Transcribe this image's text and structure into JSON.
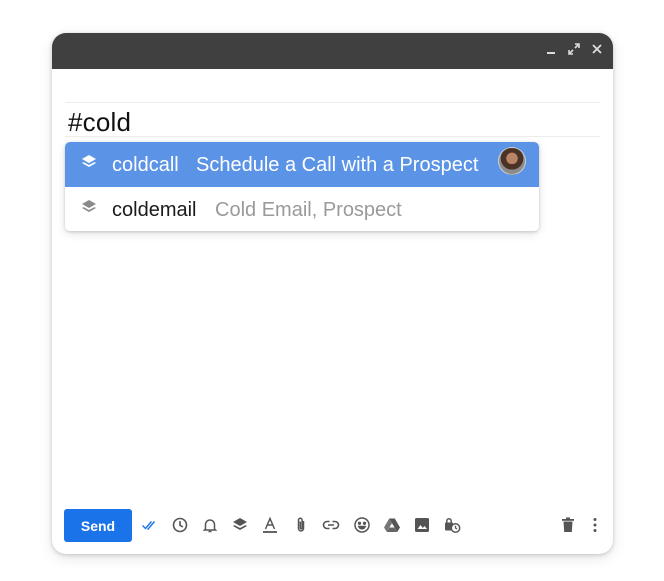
{
  "compose": {
    "body_text": "#cold",
    "window_controls": [
      "minimize-icon",
      "expand-icon",
      "close-icon"
    ]
  },
  "suggestions": [
    {
      "name": "coldcall",
      "description": "Schedule a Call with a Prospect",
      "selected": true,
      "icon": "layers-icon",
      "has_avatar": true
    },
    {
      "name": "coldemail",
      "description": "Cold Email, Prospect",
      "selected": false,
      "icon": "layers-icon",
      "has_avatar": false
    }
  ],
  "toolbar": {
    "send_label": "Send",
    "icons": [
      "double-check-icon",
      "clock-icon",
      "bell-icon",
      "layers-icon",
      "text-format-icon",
      "attachment-icon",
      "link-icon",
      "emoji-icon",
      "drive-icon",
      "image-icon",
      "confidential-icon",
      "trash-icon",
      "more-vert-icon"
    ]
  },
  "colors": {
    "titlebar": "#404040",
    "selected_row": "#5b94e6",
    "send_button": "#1a73e8",
    "check_icon": "#1a73e8"
  }
}
